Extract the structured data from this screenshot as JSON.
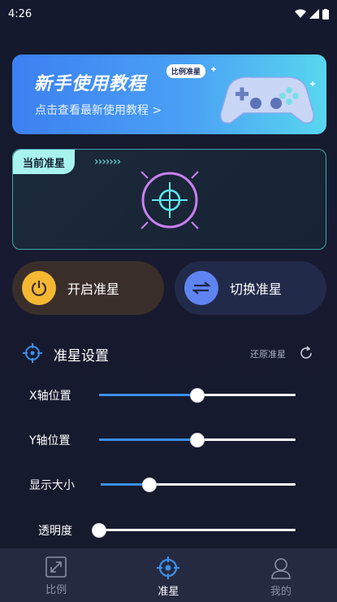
{
  "status": {
    "time": "4:26"
  },
  "banner": {
    "title": "新手使用教程",
    "subtitle": "点击查看最新使用教程 >",
    "badge": "比例准星"
  },
  "crosshair_card": {
    "tag": "当前准星",
    "chevrons": "›››››››"
  },
  "actions": {
    "start_label": "开启准星",
    "switch_label": "切换准星"
  },
  "settings": {
    "title": "准星设置",
    "restore_label": "还原准星",
    "sliders": [
      {
        "label": "X轴位置",
        "value_fraction": 0.5
      },
      {
        "label": "Y轴位置",
        "value_fraction": 0.5
      },
      {
        "label": "显示大小",
        "value_fraction": 0.25
      },
      {
        "label": "透明度",
        "value_fraction": 0.0
      }
    ]
  },
  "tabbar": {
    "tabs": [
      {
        "label": "比例",
        "icon": "resize-icon",
        "active": false
      },
      {
        "label": "准星",
        "icon": "crosshair-icon",
        "active": true
      },
      {
        "label": "我的",
        "icon": "user-icon",
        "active": false
      }
    ]
  },
  "colors": {
    "accent_blue": "#3b8fea",
    "crosshair_purple": "#c980f2",
    "crosshair_cyan": "#5ee8f0"
  }
}
